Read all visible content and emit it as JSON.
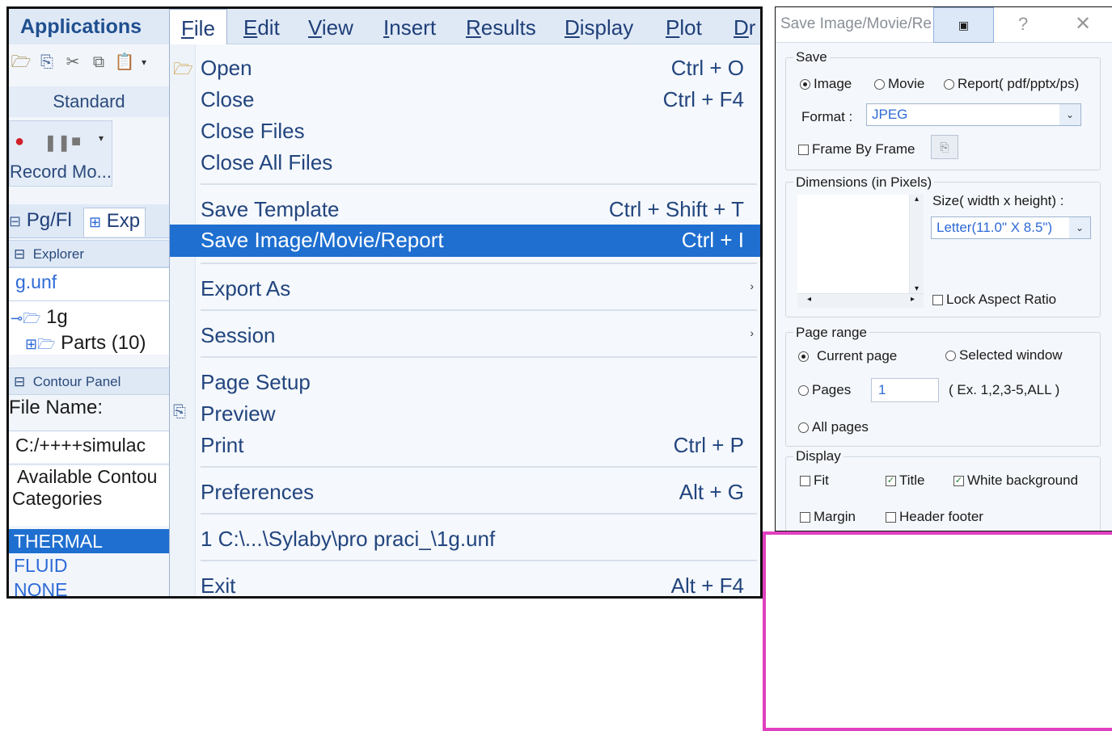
{
  "menubar": {
    "applications": "Applications",
    "items": [
      {
        "label": "File",
        "key": "F",
        "rest": "ile"
      },
      {
        "label": "Edit",
        "key": "E",
        "rest": "dit"
      },
      {
        "label": "View",
        "key": "V",
        "rest": "iew"
      },
      {
        "label": "Insert",
        "key": "I",
        "rest": "nsert"
      },
      {
        "label": "Results",
        "key": "R",
        "rest": "esults"
      },
      {
        "label": "Display",
        "key": "D",
        "rest": "isplay"
      },
      {
        "label": "Plot",
        "key": "P",
        "rest": "lot"
      },
      {
        "label": "Dr",
        "key": "D",
        "rest": "r"
      }
    ]
  },
  "left": {
    "standard_label": "Standard",
    "record_label": "Record Mo...",
    "tab1": "Pg/Fl",
    "tab2": "Exp",
    "explorer_head": "Explorer",
    "file_item": "g.unf",
    "tree_1g": "1g",
    "tree_parts": "Parts (10)",
    "contour_head": "Contour Panel",
    "file_name_label": "File Name:",
    "file_name_value": "C:/++++simulac",
    "available_line1": "Available Contou",
    "available_line2": "Categories",
    "categories": [
      "THERMAL",
      "FLUID",
      "NONE"
    ]
  },
  "file_menu": {
    "items": [
      {
        "label": "Open",
        "shortcut": "Ctrl + O"
      },
      {
        "label": "Close",
        "shortcut": "Ctrl + F4"
      },
      {
        "label": "Close Files",
        "shortcut": ""
      },
      {
        "label": "Close All Files",
        "shortcut": ""
      },
      {
        "label": "Save Template",
        "shortcut": "Ctrl + Shift + T"
      },
      {
        "label": "Save Image/Movie/Report",
        "shortcut": "Ctrl + I"
      },
      {
        "label": "Export As",
        "shortcut": ""
      },
      {
        "label": "Session",
        "shortcut": ""
      },
      {
        "label": "Page Setup",
        "shortcut": ""
      },
      {
        "label": "Preview",
        "shortcut": ""
      },
      {
        "label": "Print",
        "shortcut": "Ctrl + P"
      },
      {
        "label": "Preferences",
        "shortcut": "Alt + G"
      },
      {
        "label": "1 C:\\...\\Sylaby\\pro praci_\\1g.unf",
        "shortcut": ""
      },
      {
        "label": "Exit",
        "shortcut": "Alt + F4"
      }
    ],
    "submenu_arrow": "›"
  },
  "dialog": {
    "title": "Save Image/Movie/Re",
    "help": "?",
    "close": "✕",
    "save_group": "Save",
    "radio_image": "Image",
    "radio_movie": "Movie",
    "radio_report": "Report( pdf/pptx/ps)",
    "format_label": "Format :",
    "format_value": "JPEG",
    "frame_by_frame": "Frame By Frame",
    "dimensions_group": "Dimensions (in Pixels)",
    "size_label": "Size( width x height) :",
    "size_value": "Letter(11.0\" X 8.5\")",
    "lock_aspect": "Lock Aspect Ratio",
    "page_range_group": "Page range",
    "current_page": "Current page",
    "selected_window": "Selected window",
    "pages": "Pages",
    "pages_value": "1",
    "pages_example": "( Ex. 1,2,3-5,ALL )",
    "all_pages": "All pages",
    "display_group": "Display",
    "fit": "Fit",
    "title_opt": "Title",
    "white_bg": "White background",
    "margin": "Margin",
    "header_footer": "Header footer"
  },
  "colors": {
    "accent": "#1e6fd0",
    "annotation": "#e040c0"
  }
}
